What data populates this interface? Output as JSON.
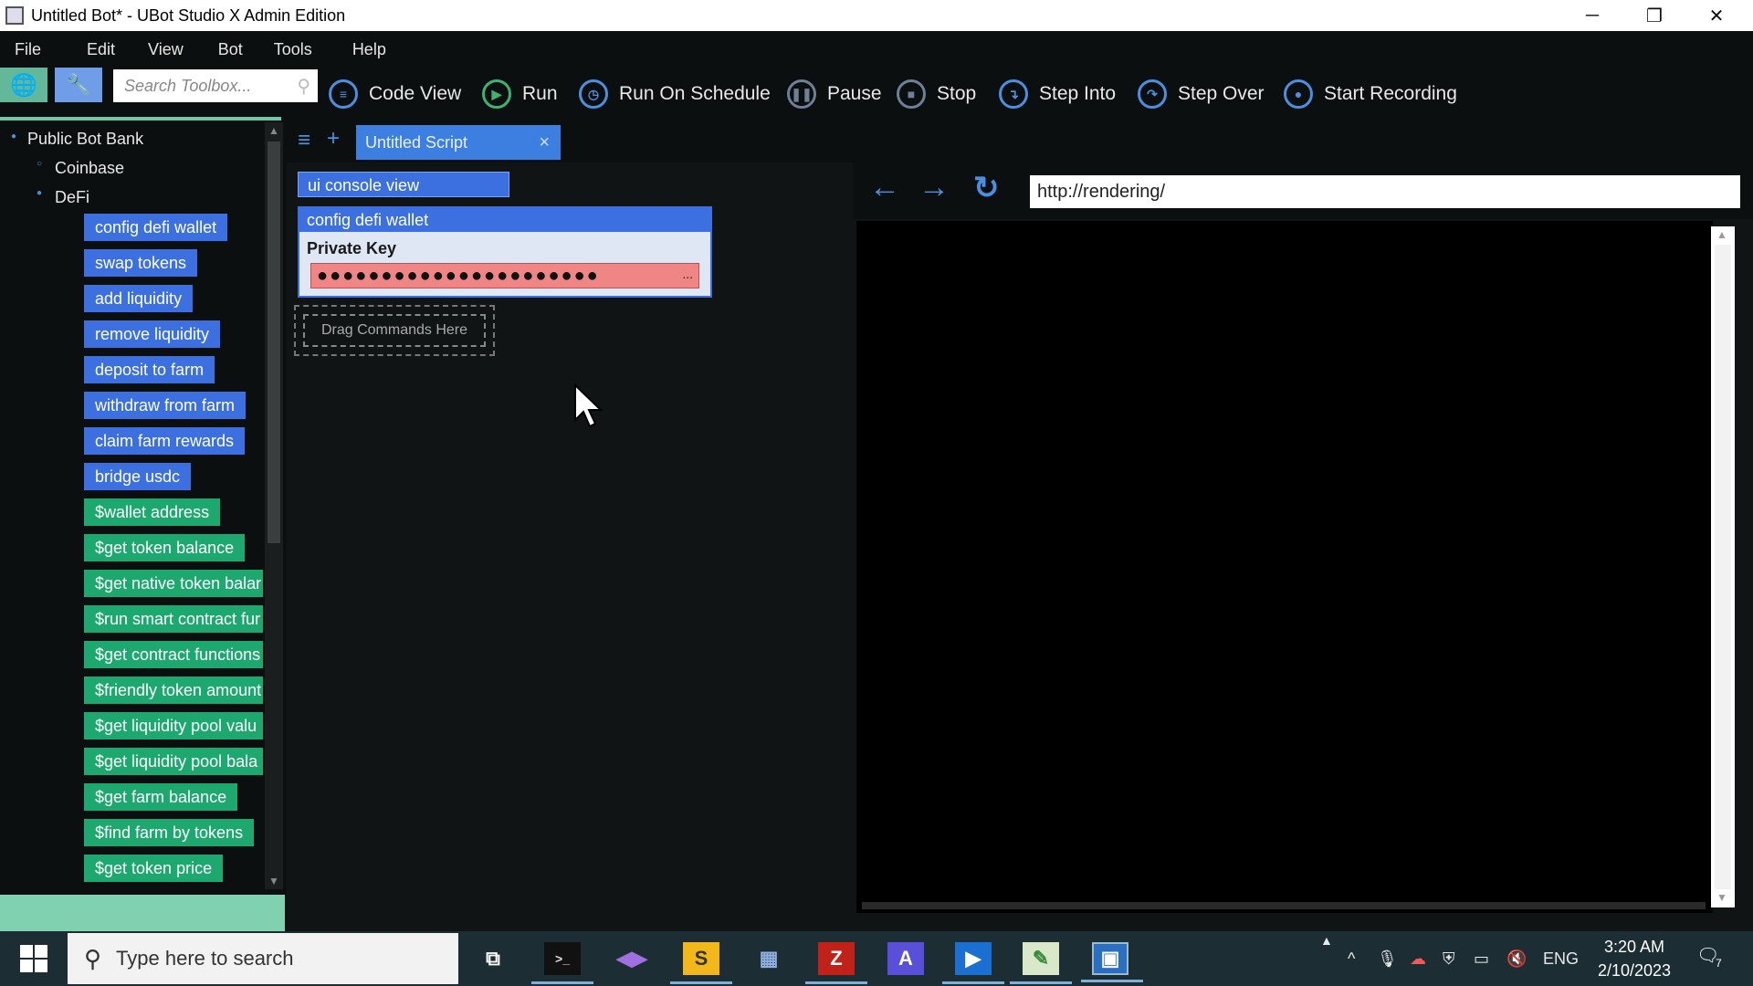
{
  "window": {
    "title": "Untitled Bot* - UBot Studio X Admin Edition",
    "minimize": "─",
    "restore": "❐",
    "close": "✕"
  },
  "menu": [
    "File",
    "Edit",
    "View",
    "Bot",
    "Tools",
    "Help"
  ],
  "toolbar": {
    "search_placeholder": "Search Toolbox...",
    "buttons": {
      "code_view": "Code View",
      "run": "Run",
      "run_on_schedule": "Run On Schedule",
      "pause": "Pause",
      "stop": "Stop",
      "step_into": "Step Into",
      "step_over": "Step Over",
      "start_recording": "Start Recording"
    }
  },
  "sidebar": {
    "tree": {
      "root": "Public Bot Bank",
      "child1": "Coinbase",
      "child2": "DeFi"
    },
    "commands": [
      "config defi wallet",
      "swap tokens",
      "add liquidity",
      "remove liquidity",
      "deposit to farm",
      "withdraw from farm",
      "claim farm rewards",
      "bridge usdc"
    ],
    "functions": [
      "$wallet address",
      "$get token balance",
      "$get native token balar",
      "$run smart contract fur",
      "$get contract functions",
      "$friendly token amount",
      "$get liquidity pool valu",
      "$get liquidity pool bala",
      "$get farm balance",
      "$find farm by tokens",
      "$get token price"
    ]
  },
  "editor": {
    "tab_label": "Untitled Script",
    "tab_close": "×",
    "commands": {
      "ui_console": "ui console view",
      "config": "config defi wallet",
      "private_key_label": "Private Key",
      "private_key_value": "●●●●●●●●●●●●●●●●●●●●●●",
      "private_key_more": "...",
      "drop_hint": "Drag Commands Here"
    }
  },
  "browser": {
    "url": "http://rendering/"
  },
  "taskbar": {
    "search_placeholder": "Type here to search",
    "tray": {
      "language": "ENG"
    },
    "clock": {
      "time": "3:20 AM",
      "date": "2/10/2023"
    },
    "notifications": "7"
  },
  "colors": {
    "accent": "#3c6fe0",
    "function_green": "#1da870",
    "run_green": "#3cb371",
    "private_key_red": "#ef8585"
  }
}
